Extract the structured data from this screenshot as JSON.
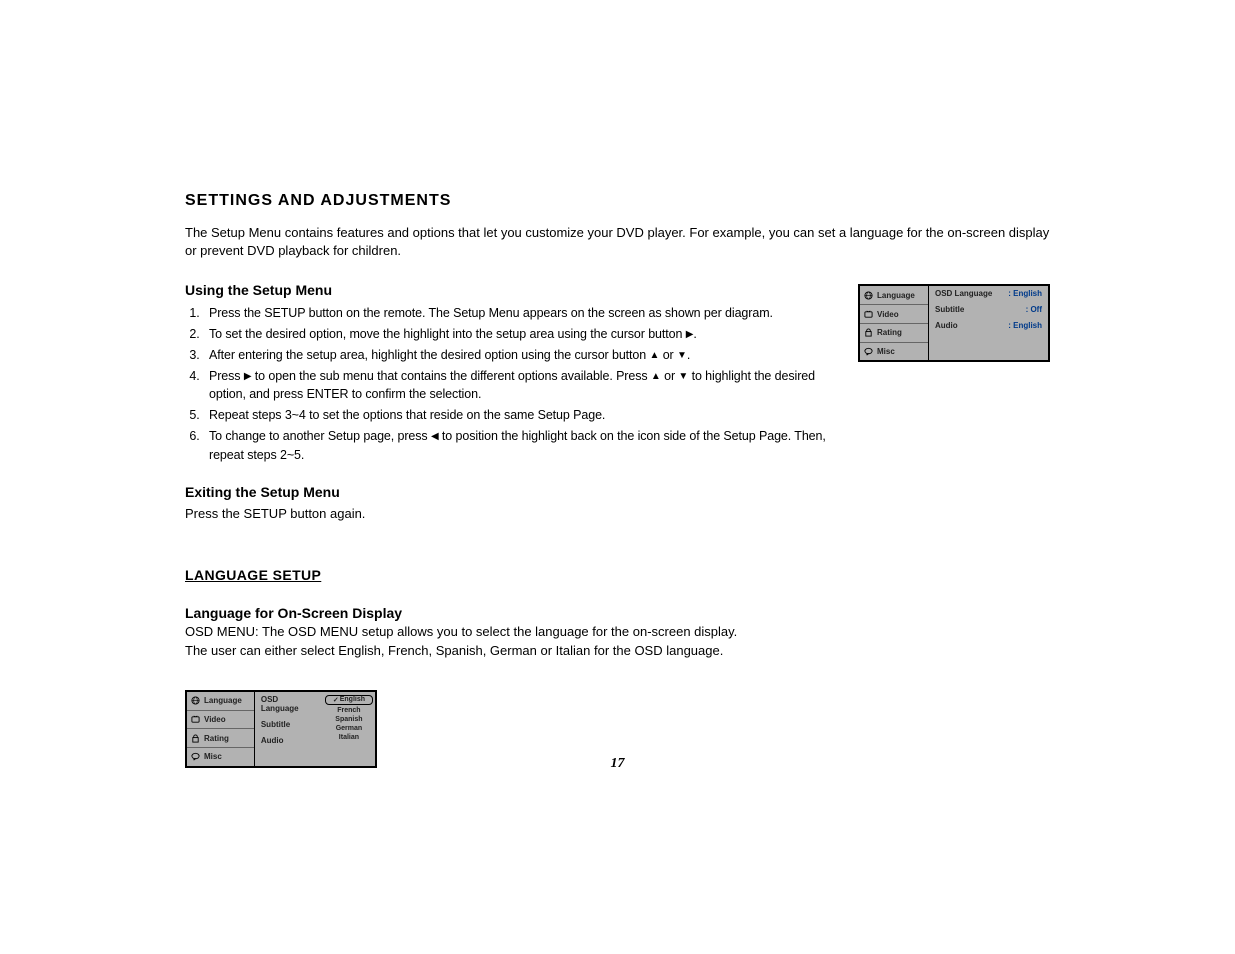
{
  "title": "SETTINGS AND ADJUSTMENTS",
  "intro": "The Setup Menu contains features and options that let you customize your DVD player. For example, you can set a language for the on-screen display or prevent DVD playback for children.",
  "using_head": "Using the Setup Menu",
  "steps": {
    "s1": "Press the SETUP button on the remote. The Setup Menu appears on the screen as shown per diagram.",
    "s2a": "To set the desired option, move the highlight into the setup area using the cursor button ",
    "s2b": ".",
    "s3a": "After entering the setup area, highlight the desired option using the cursor button ",
    "s3b": " or ",
    "s3c": ".",
    "s4a": "Press ",
    "s4b": " to open the sub menu that contains the different options available. Press ",
    "s4c": " or ",
    "s4d": " to highlight the desired option, and press ENTER to confirm the selection.",
    "s5": "Repeat steps 3~4 to set the options that reside on the same Setup Page.",
    "s6a": "To change to another Setup page, press ",
    "s6b": " to position the highlight back on the icon side of the Setup Page. Then, repeat steps 2~5."
  },
  "arrows": {
    "right": "▶",
    "left": "◀",
    "up": "▲",
    "down": "▼"
  },
  "exit_head": "Exiting the Setup Menu",
  "exit_text": "Press the SETUP button again.",
  "lang_setup_head": "LANGUAGE SETUP",
  "osd_head": "Language for On-Screen Display",
  "osd_text1": "OSD MENU: The OSD MENU setup allows you to select the language for the on-screen display.",
  "osd_text2": "The user can either select English, French, Spanish, German or Italian for the OSD language.",
  "menu1": {
    "side": [
      {
        "label": "Language"
      },
      {
        "label": "Video"
      },
      {
        "label": "Rating"
      },
      {
        "label": "Misc"
      }
    ],
    "rows": [
      {
        "label": "OSD Language",
        "value": ": English"
      },
      {
        "label": "Subtitle",
        "value": ": Off"
      },
      {
        "label": "Audio",
        "value": ": English"
      }
    ]
  },
  "menu2": {
    "side": [
      {
        "label": "Language"
      },
      {
        "label": "Video"
      },
      {
        "label": "Rating"
      },
      {
        "label": "Misc"
      }
    ],
    "mid": [
      {
        "label": "OSD Language"
      },
      {
        "label": "Subtitle"
      },
      {
        "label": "Audio"
      }
    ],
    "opts": [
      "English",
      "French",
      "Spanish",
      "German",
      "Italian"
    ],
    "check": "✓"
  },
  "page_number": "17"
}
